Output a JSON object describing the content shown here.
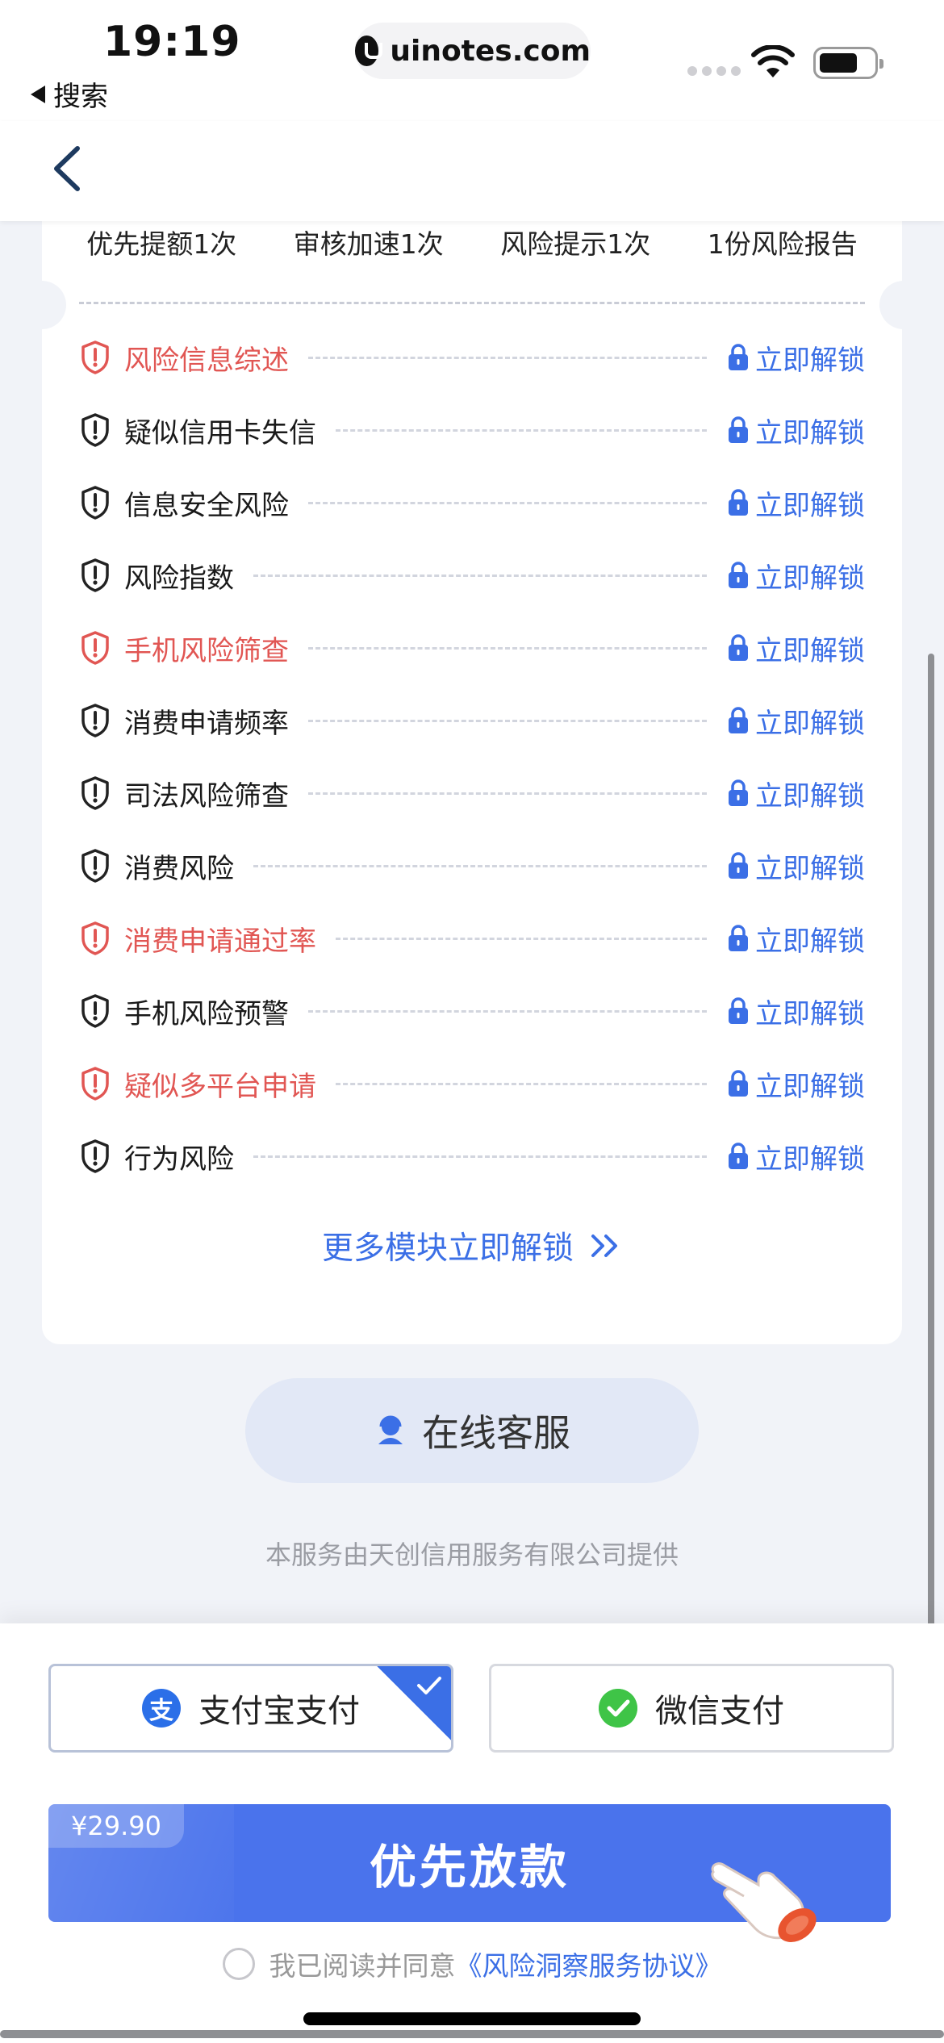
{
  "status_bar": {
    "time": "19:19",
    "back_app": "搜索",
    "url": "uinotes.com"
  },
  "perks": [
    "优先提额1次",
    "审核加速1次",
    "风险提示1次",
    "1份风险报告"
  ],
  "risk_items": [
    {
      "label": "风险信息综述",
      "highlight": true,
      "action": "立即解锁"
    },
    {
      "label": "疑似信用卡失信",
      "highlight": false,
      "action": "立即解锁"
    },
    {
      "label": "信息安全风险",
      "highlight": false,
      "action": "立即解锁"
    },
    {
      "label": "风险指数",
      "highlight": false,
      "action": "立即解锁"
    },
    {
      "label": "手机风险筛查",
      "highlight": true,
      "action": "立即解锁"
    },
    {
      "label": "消费申请频率",
      "highlight": false,
      "action": "立即解锁"
    },
    {
      "label": "司法风险筛查",
      "highlight": false,
      "action": "立即解锁"
    },
    {
      "label": "消费风险",
      "highlight": false,
      "action": "立即解锁"
    },
    {
      "label": "消费申请通过率",
      "highlight": true,
      "action": "立即解锁"
    },
    {
      "label": "手机风险预警",
      "highlight": false,
      "action": "立即解锁"
    },
    {
      "label": "疑似多平台申请",
      "highlight": true,
      "action": "立即解锁"
    },
    {
      "label": "行为风险",
      "highlight": false,
      "action": "立即解锁"
    }
  ],
  "more_modules": "更多模块立即解锁",
  "online_service": "在线客服",
  "provider_note": "本服务由天创信用服务有限公司提供",
  "payment": {
    "alipay": {
      "label": "支付宝支付",
      "icon_char": "支",
      "selected": true
    },
    "wechat": {
      "label": "微信支付",
      "selected": false
    }
  },
  "cta": {
    "price": "¥29.90",
    "label": "优先放款"
  },
  "agreement": {
    "prefix": "我已阅读并同意",
    "link": "《风险洞察服务协议》",
    "checked": false
  },
  "colors": {
    "accent": "#3b6fe6",
    "cta": "#4a73ec",
    "risk_red": "#e15653",
    "wechat_green": "#3fc447",
    "page_bg": "#f1f3f8"
  }
}
